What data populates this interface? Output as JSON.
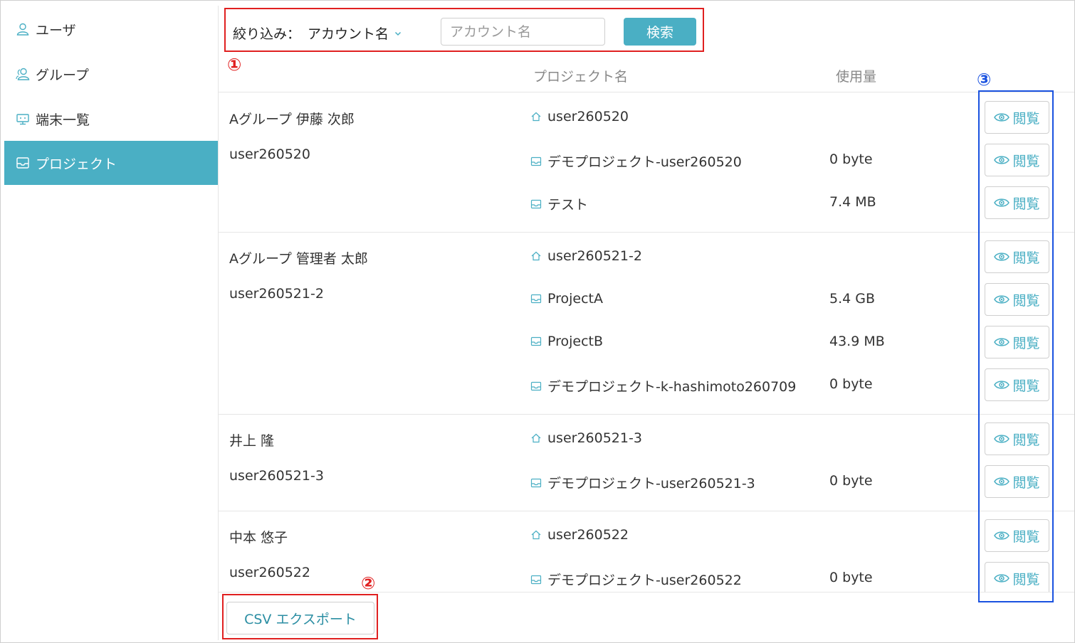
{
  "sidebar": {
    "items": [
      {
        "label": "ユーザ",
        "icon": "user-icon",
        "active": false
      },
      {
        "label": "グループ",
        "icon": "group-icon",
        "active": false
      },
      {
        "label": "端末一覧",
        "icon": "device-icon",
        "active": false
      },
      {
        "label": "プロジェクト",
        "icon": "project-icon",
        "active": true
      }
    ]
  },
  "filter": {
    "label": "絞り込み：",
    "select_value": "アカウント名",
    "search_placeholder": "アカウント名",
    "search_button": "検索"
  },
  "table": {
    "headers": {
      "project": "プロジェクト名",
      "usage": "使用量"
    },
    "view_label": "閲覧",
    "groups": [
      {
        "name": "Aグループ 伊藤 次郎",
        "user": "user260520",
        "projects": [
          {
            "icon": "home-icon",
            "name": "user260520",
            "usage": ""
          },
          {
            "icon": "project-icon",
            "name": "デモプロジェクト-user260520",
            "usage": "0 byte"
          },
          {
            "icon": "project-icon",
            "name": "テスト",
            "usage": "7.4 MB"
          }
        ]
      },
      {
        "name": "Aグループ 管理者 太郎",
        "user": "user260521-2",
        "projects": [
          {
            "icon": "home-icon",
            "name": "user260521-2",
            "usage": ""
          },
          {
            "icon": "project-icon",
            "name": "ProjectA",
            "usage": "5.4 GB"
          },
          {
            "icon": "project-icon",
            "name": "ProjectB",
            "usage": "43.9 MB"
          },
          {
            "icon": "project-icon",
            "name": "デモプロジェクト-k-hashimoto260709",
            "usage": "0 byte"
          }
        ]
      },
      {
        "name": "井上 隆",
        "user": "user260521-3",
        "projects": [
          {
            "icon": "home-icon",
            "name": "user260521-3",
            "usage": ""
          },
          {
            "icon": "project-icon",
            "name": "デモプロジェクト-user260521-3",
            "usage": "0 byte"
          }
        ]
      },
      {
        "name": "中本 悠子",
        "user": "user260522",
        "projects": [
          {
            "icon": "home-icon",
            "name": "user260522",
            "usage": ""
          },
          {
            "icon": "project-icon",
            "name": "デモプロジェクト-user260522",
            "usage": "0 byte"
          }
        ]
      }
    ]
  },
  "footer": {
    "csv_button": "CSV エクスポート"
  },
  "annotations": [
    "①",
    "②",
    "③"
  ],
  "colors": {
    "accent": "#4aafc4",
    "annotation_red": "#e02020",
    "annotation_blue": "#1a52e0"
  }
}
